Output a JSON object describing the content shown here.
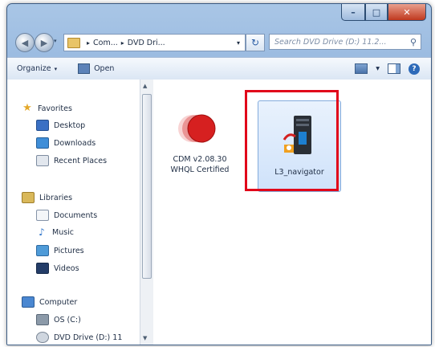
{
  "window": {
    "title_buttons": {
      "minimize": "–",
      "maximize": "□",
      "close": "✕"
    }
  },
  "address": {
    "back_icon": "◀",
    "forward_icon": "▶",
    "dropdown_icon": "▾",
    "crumbs": [
      "Com...",
      "DVD Dri..."
    ],
    "refresh_icon": "↻",
    "search_placeholder": "Search DVD Drive (D:) 11.2...",
    "search_icon": "⚲"
  },
  "toolbar": {
    "organize_label": "Organize",
    "open_label": "Open",
    "dropdown_icon": "▾",
    "help_icon": "?"
  },
  "nav": {
    "favorites": "Favorites",
    "desktop": "Desktop",
    "downloads": "Downloads",
    "recent_places": "Recent Places",
    "libraries": "Libraries",
    "documents": "Documents",
    "music": "Music",
    "pictures": "Pictures",
    "videos": "Videos",
    "computer": "Computer",
    "os": "OS (C:)",
    "dvd": "DVD Drive (D:) 11"
  },
  "files": [
    {
      "name_line1": "CDM v2.08.30",
      "name_line2": "WHQL Certified",
      "icon": "cdm-red-circle-icon"
    },
    {
      "name_line1": "L3_navigator",
      "icon": "server-application-icon",
      "selected": true
    }
  ],
  "colors": {
    "highlight_box": "#e1061a",
    "selection": "#cfe2fa"
  }
}
